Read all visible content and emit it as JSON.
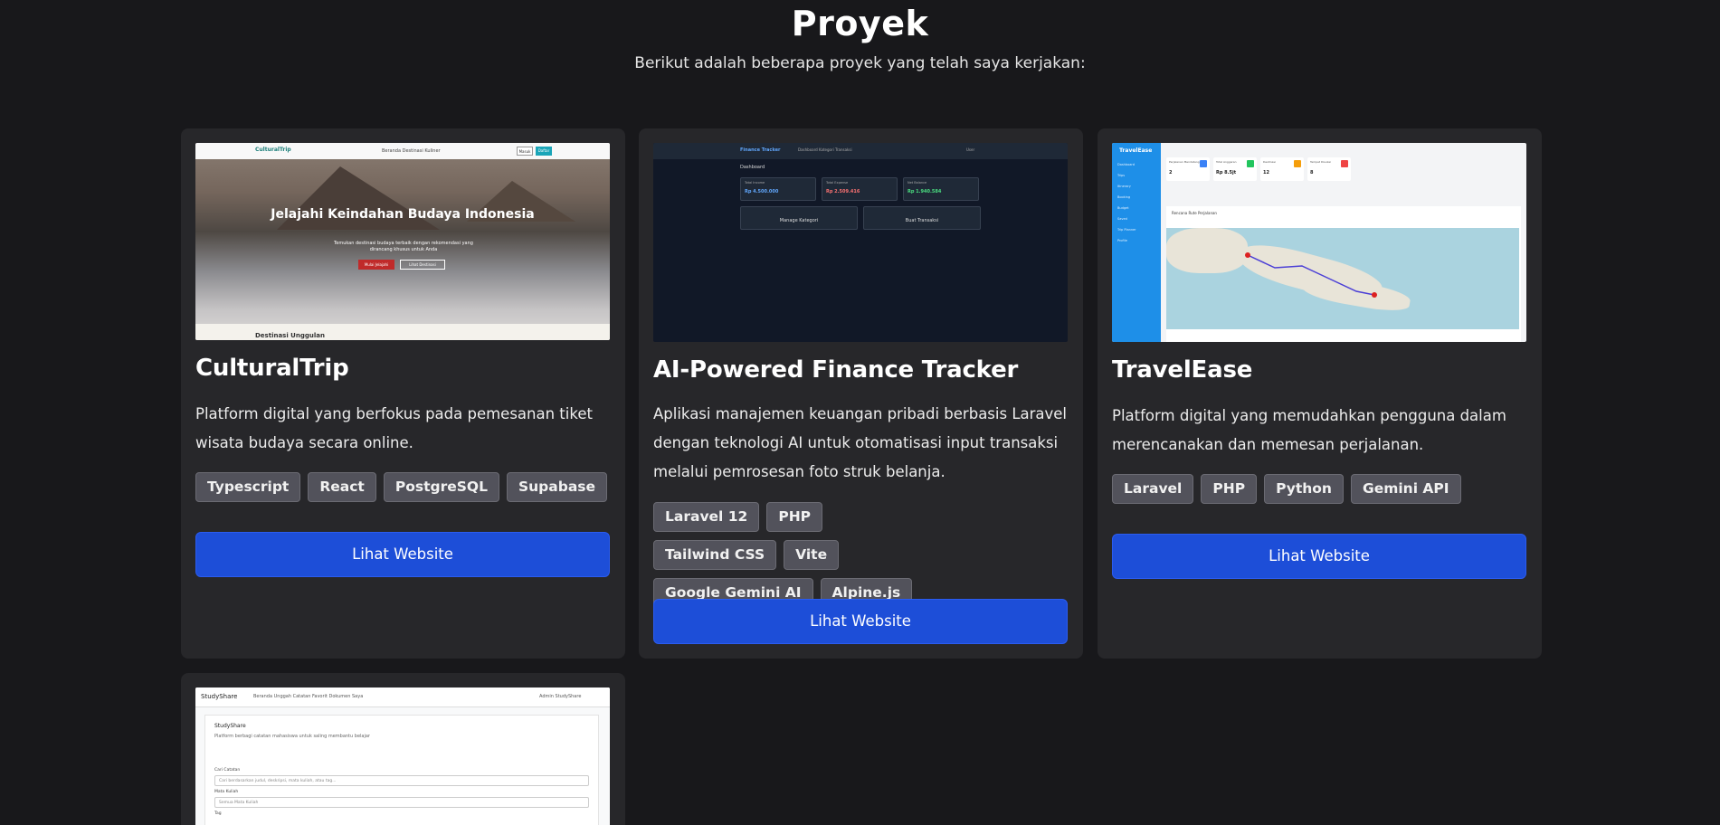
{
  "section": {
    "title": "Proyek",
    "subtitle": "Berikut adalah beberapa proyek yang telah saya kerjakan:"
  },
  "projects": [
    {
      "title": "CulturalTrip",
      "description": "Platform digital yang berfokus pada pemesanan tiket wisata budaya secara online.",
      "tags": [
        "Typescript",
        "React",
        "PostgreSQL",
        "Supabase"
      ],
      "button": "Lihat Website",
      "preview": {
        "logo": "CulturalTrip",
        "nav_links": "Beranda  Destinasi  Kuliner",
        "nav_btn1": "Masuk",
        "nav_btn2": "Daftar",
        "hero": "Jelajahi Keindahan Budaya Indonesia",
        "hero_sub": "Temukan destinasi budaya terbaik dengan rekomendasi yang dirancang khusus untuk Anda",
        "hero_btn1": "Mulai Jelajahi",
        "hero_btn2": "Lihat Destinasi",
        "section": "Destinasi Unggulan"
      }
    },
    {
      "title": "AI-Powered Finance Tracker",
      "description": "Aplikasi manajemen keuangan pribadi berbasis Laravel dengan teknologi AI untuk otomatisasi input transaksi melalui pemrosesan foto struk belanja.",
      "tags": [
        "Laravel 12",
        "PHP",
        "Tailwind CSS",
        "Vite",
        "Google Gemini AI",
        "Alpine.js"
      ],
      "button": "Lihat Website",
      "preview": {
        "app": "Finance Tracker",
        "nav_links": "Dashboard   Kategori   Transaksi",
        "user": "User",
        "heading": "Dashboard",
        "stats": [
          {
            "label": "Total Income",
            "value": "Rp 4.500.000",
            "color": "#60a5fa"
          },
          {
            "label": "Total Expense",
            "value": "Rp 2.509.416",
            "color": "#f87171"
          },
          {
            "label": "Net Balance",
            "value": "Rp 1.940.584",
            "color": "#4ade80"
          }
        ],
        "actions": [
          "Manage Kategori",
          "Buat Transaksi"
        ]
      }
    },
    {
      "title": "TravelEase",
      "description": "Platform digital yang memudahkan pengguna dalam merencanakan dan memesan perjalanan.",
      "tags": [
        "Laravel",
        "PHP",
        "Python",
        "Gemini API"
      ],
      "button": "Lihat Website",
      "preview": {
        "brand": "TravelEase",
        "menu": [
          "Dashboard",
          "Trips",
          "Itinerary",
          "Booking",
          "Budget",
          "Saved",
          "Trip Planner",
          "Profile"
        ],
        "stats": [
          {
            "label": "Perjalanan Mendatang",
            "value": "2",
            "color": "#3b82f6"
          },
          {
            "label": "Total Anggaran",
            "value": "Rp 8.5jt",
            "color": "#22c55e"
          },
          {
            "label": "Destinasi",
            "value": "12",
            "color": "#f59e0b"
          },
          {
            "label": "Tempat Disukai",
            "value": "8",
            "color": "#ef4444"
          }
        ],
        "panel_title": "Rencana Rute Perjalanan"
      }
    },
    {
      "preview": {
        "brand": "StudyShare",
        "nav_links": "Beranda   Unggah Catatan   Favorit   Dokumen Saya",
        "user": "Admin StudyShare",
        "box_title": "StudyShare",
        "box_sub": "Platform berbagi catatan mahasiswa untuk saling membantu belajar",
        "label1": "Cari Catatan",
        "placeholder1": "Cari berdasarkan judul, deskripsi, mata kuliah, atau tag...",
        "label2": "Mata Kuliah",
        "select2": "Semua Mata Kuliah",
        "label3": "Tag"
      }
    }
  ]
}
